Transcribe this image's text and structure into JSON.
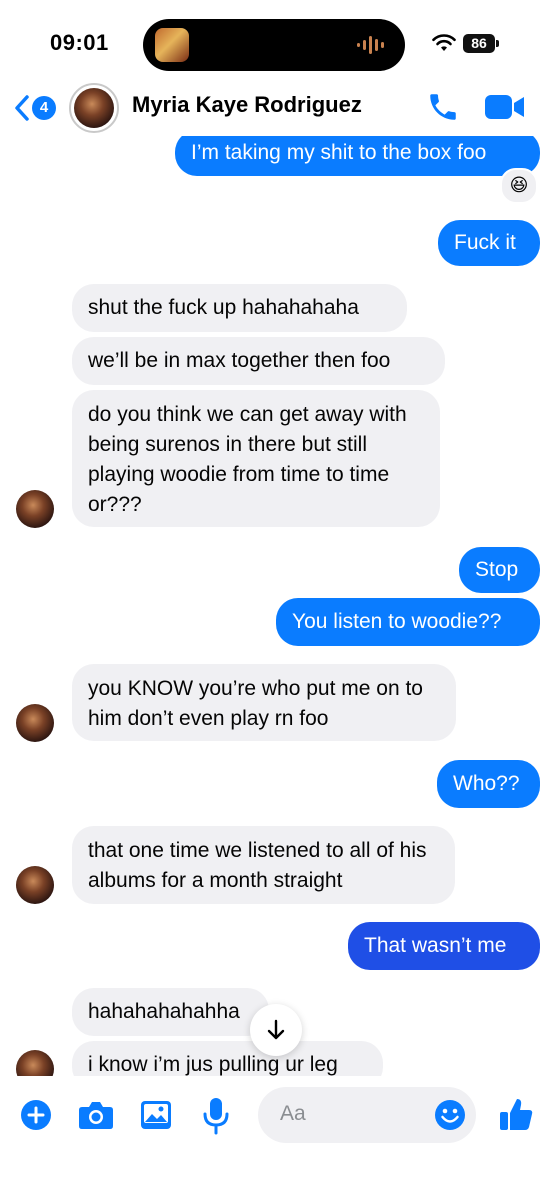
{
  "status": {
    "time": "09:01",
    "battery": "86"
  },
  "header": {
    "back_count": "4",
    "contact_name": "Myria Kaye Rodriguez"
  },
  "messages": [
    {
      "side": "out",
      "text": "I’m taking my shit to the box foo"
    },
    {
      "side": "reaction",
      "text": "😆"
    },
    {
      "side": "out",
      "text": "Fuck it"
    },
    {
      "side": "in",
      "text": "shut the fuck up hahahahaha"
    },
    {
      "side": "in",
      "text": "we’ll be in max together then foo"
    },
    {
      "side": "in",
      "text": "do you think we can get away with being surenos in there but still playing woodie from time to time or???"
    },
    {
      "side": "out",
      "text": "Stop"
    },
    {
      "side": "out",
      "text": "You listen to woodie??"
    },
    {
      "side": "in",
      "text": "you KNOW you’re who put me on to him don’t even play rn foo"
    },
    {
      "side": "out",
      "text": "Who??"
    },
    {
      "side": "in",
      "text": "that one time we listened to all of his albums for a month straight"
    },
    {
      "side": "out",
      "text": "That wasn’t me"
    },
    {
      "side": "in",
      "text": "hahahahahahha"
    },
    {
      "side": "in",
      "text": "i know i’m jus pulling ur leg"
    }
  ],
  "composer": {
    "placeholder": "Aa"
  },
  "colors": {
    "accent": "#0a7cff",
    "accent_dark": "#1f4fe6",
    "incoming_bg": "#f0f0f3"
  },
  "icons": [
    "back-chevron-icon",
    "phone-icon",
    "video-camera-icon",
    "plus-icon",
    "camera-icon",
    "photo-icon",
    "microphone-icon",
    "emoji-icon",
    "thumbs-up-icon",
    "arrow-down-icon"
  ]
}
